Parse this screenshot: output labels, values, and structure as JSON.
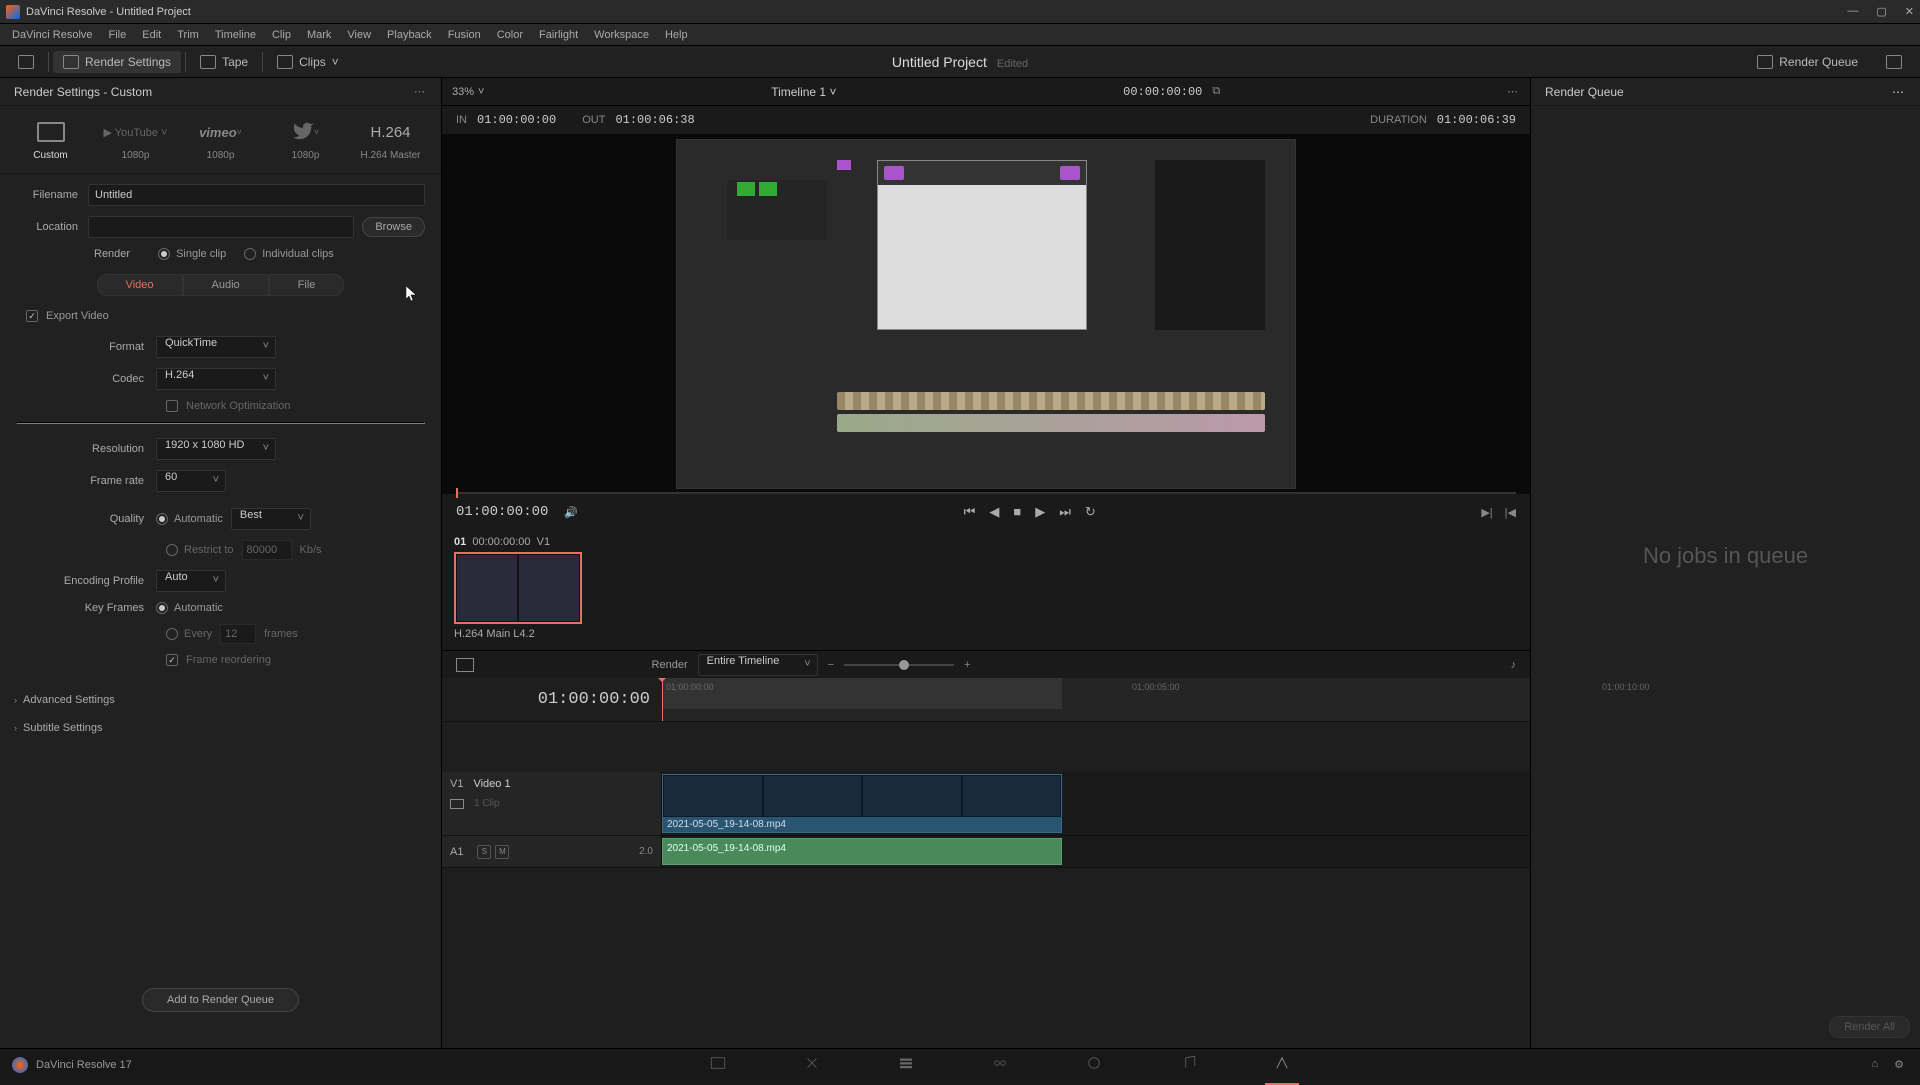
{
  "titlebar": {
    "text": "DaVinci Resolve - Untitled Project"
  },
  "menubar": [
    "DaVinci Resolve",
    "File",
    "Edit",
    "Trim",
    "Timeline",
    "Clip",
    "Mark",
    "View",
    "Playback",
    "Fusion",
    "Color",
    "Fairlight",
    "Workspace",
    "Help"
  ],
  "toolbar": {
    "render_settings": "Render Settings",
    "tape": "Tape",
    "clips": "Clips",
    "project_title": "Untitled Project",
    "edited": "Edited",
    "render_queue": "Render Queue"
  },
  "left": {
    "title": "Render Settings - Custom",
    "presets": [
      {
        "label": "Custom",
        "active": true
      },
      {
        "label": "1080p"
      },
      {
        "label": "1080p"
      },
      {
        "label": "1080p"
      },
      {
        "label": "H.264 Master"
      }
    ],
    "youtube_text": "YouTube",
    "vimeo_text": "vimeo",
    "h264_text": "H.264",
    "filename_label": "Filename",
    "filename": "Untitled",
    "location_label": "Location",
    "location": "",
    "browse": "Browse",
    "render_label": "Render",
    "single": "Single clip",
    "individual": "Individual clips",
    "tabs": {
      "video": "Video",
      "audio": "Audio",
      "file": "File"
    },
    "export_video": "Export Video",
    "format_label": "Format",
    "format": "QuickTime",
    "codec_label": "Codec",
    "codec": "H.264",
    "netopt": "Network Optimization",
    "resolution_label": "Resolution",
    "resolution": "1920 x 1080 HD",
    "framerate_label": "Frame rate",
    "framerate": "60",
    "quality_label": "Quality",
    "quality_auto": "Automatic",
    "quality_best": "Best",
    "restrict": "Restrict to",
    "restrict_val": "80000",
    "kbps": "Kb/s",
    "encprof_label": "Encoding Profile",
    "encprof": "Auto",
    "keyframes_label": "Key Frames",
    "kf_auto": "Automatic",
    "kf_every": "Every",
    "kf_val": "12",
    "kf_frames": "frames",
    "frame_reorder": "Frame reordering",
    "advanced": "Advanced Settings",
    "subtitle": "Subtitle Settings",
    "add_queue": "Add to Render Queue"
  },
  "center": {
    "zoom": "33%",
    "timeline_name": "Timeline 1",
    "timecode": "00:00:00:00",
    "in_label": "IN",
    "in": "01:00:00:00",
    "out_label": "OUT",
    "out": "01:00:06:38",
    "dur_label": "DURATION",
    "dur": "01:00:06:39",
    "playhead_tc": "01:00:00:00",
    "clip_num": "01",
    "clip_tc": "00:00:00:00",
    "clip_track": "V1",
    "clip_label": "H.264 Main L4.2",
    "render_label": "Render",
    "render_scope": "Entire Timeline",
    "tl_tc": "01:00:00:00",
    "tick1": "01:00:00:00",
    "tick2": "01:00:05:00",
    "tick3": "01:00:10:00",
    "v1": "V1",
    "v1_name": "Video 1",
    "v1_sub": "1 Clip",
    "a1": "A1",
    "a1_val": "2.0",
    "clip_file": "2021-05-05_19-14-08.mp4"
  },
  "right": {
    "title": "Render Queue",
    "empty": "No jobs in queue",
    "render_all": "Render All"
  },
  "bottom": {
    "app": "DaVinci Resolve 17"
  }
}
